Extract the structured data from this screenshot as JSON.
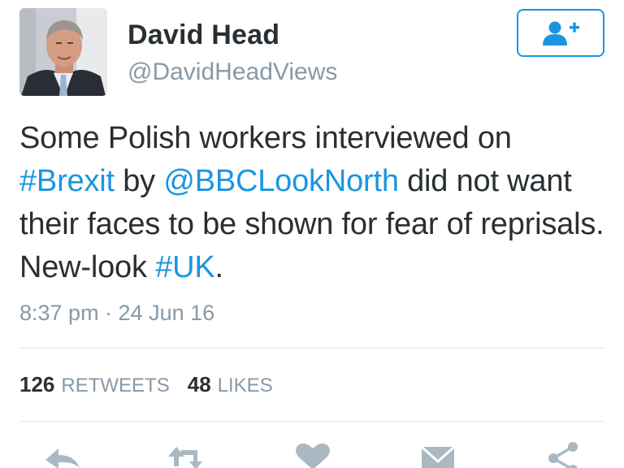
{
  "author": {
    "display_name": "David Head",
    "handle": "@DavidHeadViews",
    "avatar_icon": "profile-photo"
  },
  "follow_button": {
    "icon": "add-user-icon",
    "color": "#1b95e0"
  },
  "tweet": {
    "segments": [
      {
        "text": "Some Polish workers interviewed on ",
        "type": "text"
      },
      {
        "text": "#Brexit",
        "type": "hashtag"
      },
      {
        "text": " by ",
        "type": "text"
      },
      {
        "text": "@BBCLookNorth",
        "type": "mention"
      },
      {
        "text": " did not want their faces to be shown for fear of reprisals. New-look ",
        "type": "text"
      },
      {
        "text": "#UK",
        "type": "hashtag"
      },
      {
        "text": ".",
        "type": "text"
      }
    ],
    "timestamp": "8:37 pm · 24 Jun 16"
  },
  "stats": {
    "retweets_count": "126",
    "retweets_label": "RETWEETS",
    "likes_count": "48",
    "likes_label": "LIKES"
  },
  "actions": [
    "reply-icon",
    "retweet-icon",
    "like-icon",
    "message-icon",
    "share-icon"
  ],
  "colors": {
    "link": "#1b95e0",
    "muted": "#8899a6",
    "text": "#292f33",
    "icon": "#aab8c2"
  }
}
